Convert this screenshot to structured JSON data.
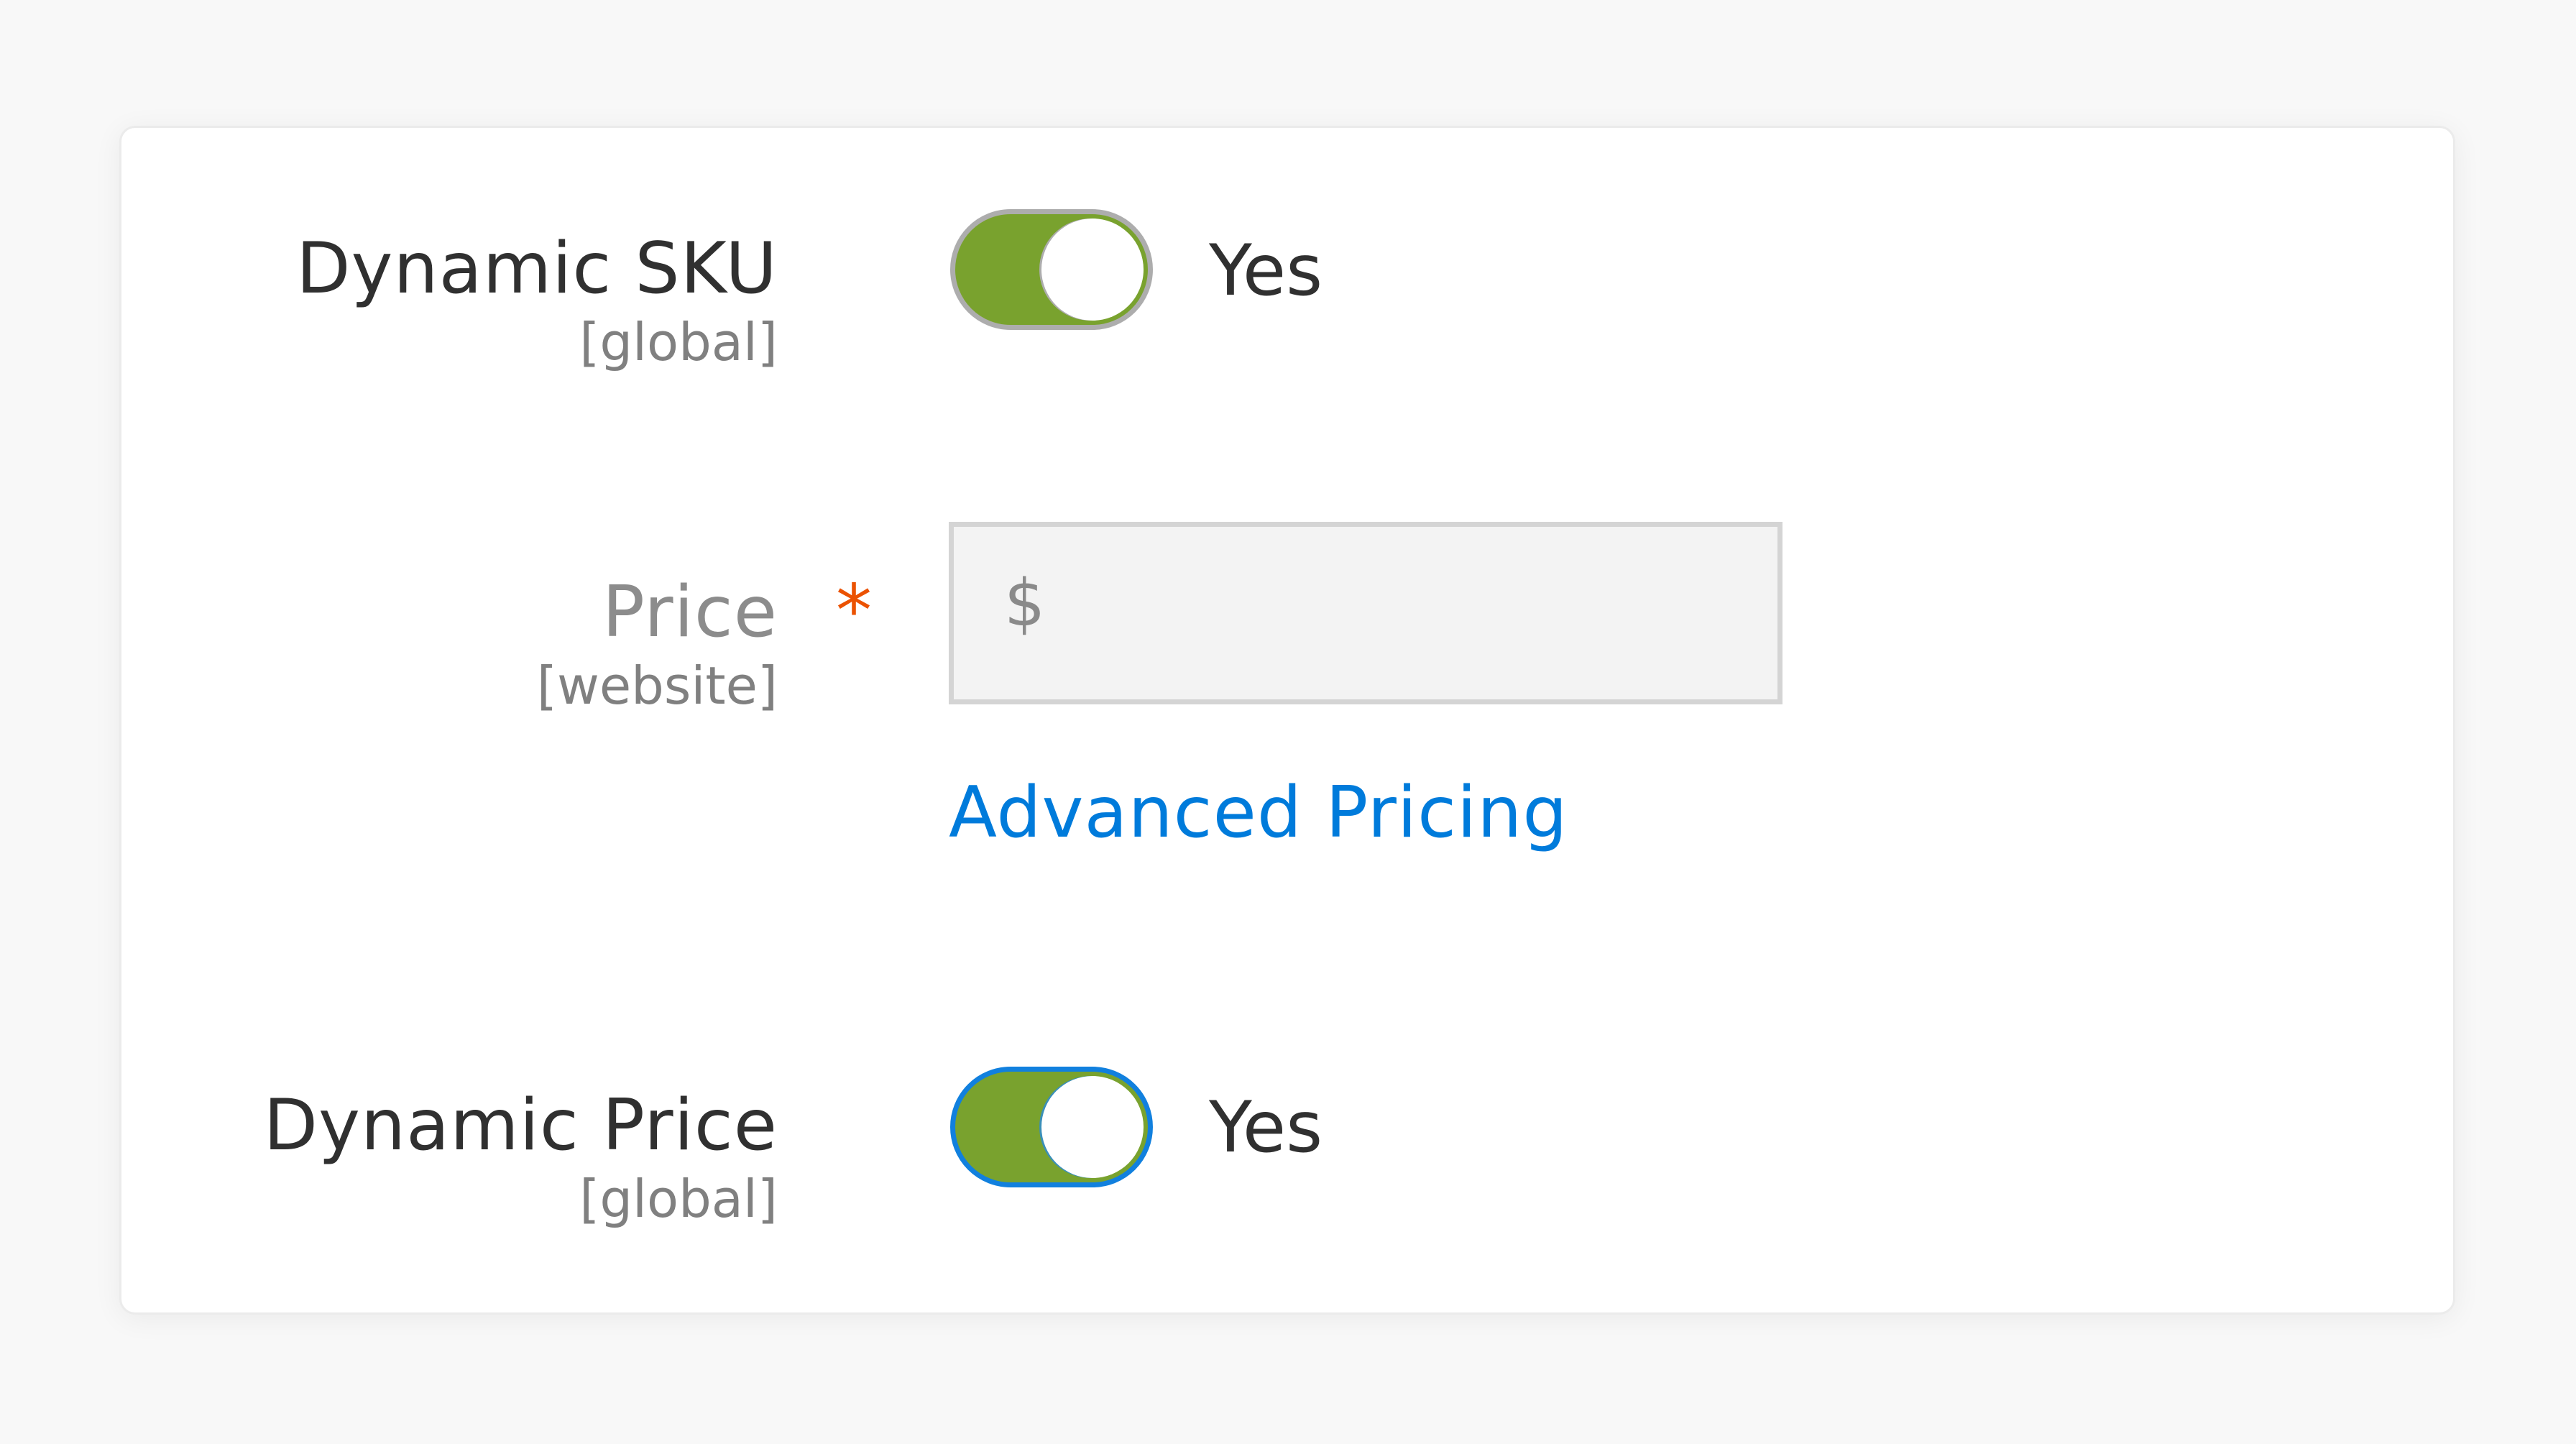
{
  "fields": {
    "dynamic_sku": {
      "label": "Dynamic SKU",
      "scope": "[global]",
      "enabled": true,
      "value_label": "Yes"
    },
    "price": {
      "label": "Price",
      "scope": "[website]",
      "required_marker": "*",
      "currency_symbol": "$",
      "value": "",
      "disabled": true
    },
    "advanced_pricing": {
      "link_text": "Advanced Pricing"
    },
    "dynamic_price": {
      "label": "Dynamic Price",
      "scope": "[global]",
      "enabled": true,
      "value_label": "Yes",
      "focused": true
    }
  },
  "colors": {
    "toggle_on": "#79a22e",
    "toggle_focus_border": "#1180de",
    "required_asterisk": "#eb5202",
    "link": "#007bdb",
    "disabled_input_bg": "#f3f3f3"
  }
}
